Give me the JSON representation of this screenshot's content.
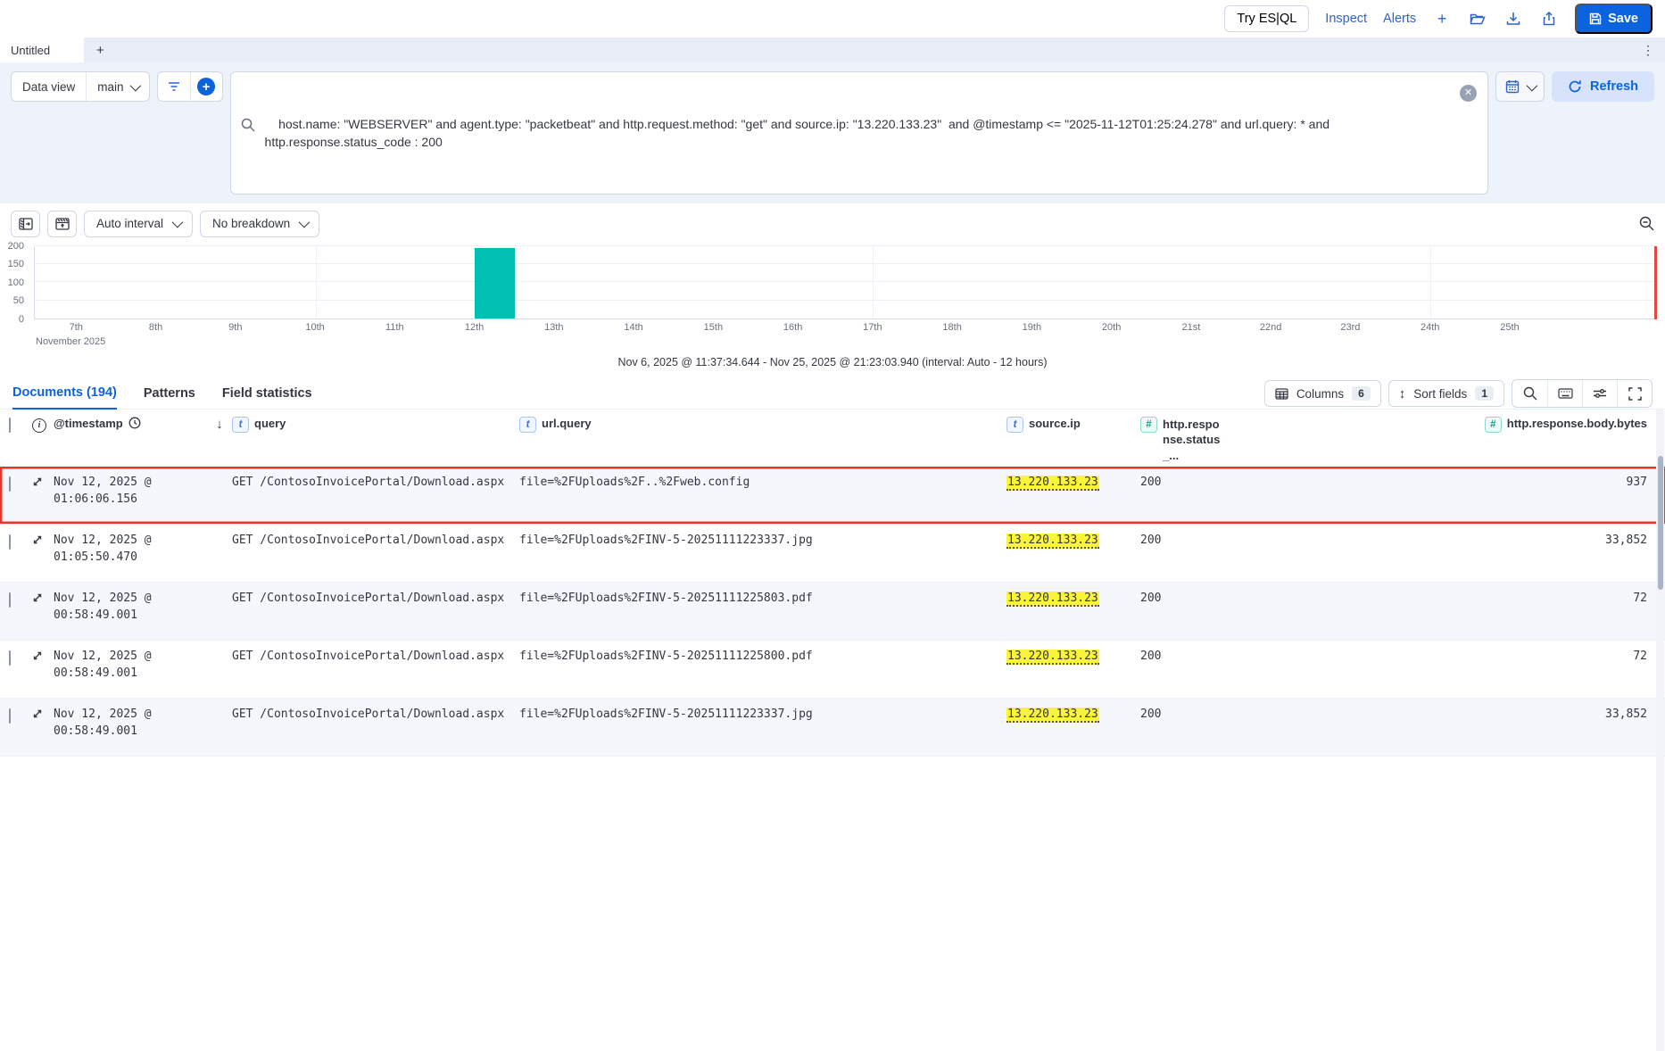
{
  "header": {
    "try_esql": "Try ES|QL",
    "inspect": "Inspect",
    "alerts": "Alerts",
    "save": "Save",
    "plus": "+"
  },
  "tab_bar": {
    "tab_title": "Untitled",
    "add": "+",
    "kebab": "⋮"
  },
  "query_bar": {
    "data_view_label": "Data view",
    "data_view_value": "main",
    "query": "host.name: \"WEBSERVER\" and agent.type: \"packetbeat\" and http.request.method: \"get\" and source.ip: \"13.220.133.23\"  and @timestamp <= \"2025-11-12T01:25:24.278\" and url.query: * and http.response.status_code : 200",
    "clear": "✕",
    "refresh": "Refresh"
  },
  "chart_controls": {
    "interval": "Auto interval",
    "breakdown": "No breakdown"
  },
  "chart_data": {
    "type": "bar",
    "title": "",
    "xlabel": "November 2025",
    "ylabel": "",
    "ylim": [
      0,
      200
    ],
    "y_ticks": [
      0,
      50,
      100,
      150,
      200
    ],
    "categories": [
      "7th",
      "8th",
      "9th",
      "10th",
      "11th",
      "12th",
      "13th",
      "14th",
      "15th",
      "16th",
      "17th",
      "18th",
      "19th",
      "20th",
      "21st",
      "22nd",
      "23rd",
      "24th",
      "25th"
    ],
    "values": [
      0,
      0,
      0,
      0,
      0,
      194,
      0,
      0,
      0,
      0,
      0,
      0,
      0,
      0,
      0,
      0,
      0,
      0,
      0
    ],
    "bars": [
      {
        "category_index": 5,
        "category": "12th",
        "value": 194
      }
    ],
    "week_gridlines": [
      3,
      10,
      17
    ],
    "bar_color": "#00BFB3",
    "now_line_color": "#e5493d",
    "grid": true,
    "legend_position": "none",
    "interval": "12 hours"
  },
  "summary": "Nov 6, 2025 @ 11:37:34.644 - Nov 25, 2025 @ 21:23:03.940 (interval: Auto - 12 hours)",
  "doc_tabs": {
    "documents": "Documents (194)",
    "patterns": "Patterns",
    "field_statistics": "Field statistics"
  },
  "grid_controls": {
    "columns_label": "Columns",
    "columns_count": "6",
    "sort_label": "Sort fields",
    "sort_count": "1"
  },
  "table": {
    "headers": {
      "timestamp": "@timestamp",
      "sort_arrow": "↓",
      "query": "query",
      "url_query": "url.query",
      "source_ip": "source.ip",
      "status_code": "http.response.status_...",
      "body_bytes": "http.response.body.bytes"
    },
    "rows": [
      {
        "timestamp": "Nov 12, 2025 @ 01:06:06.156",
        "query": "GET /ContosoInvoicePortal/Download.aspx",
        "url_query": "file=%2FUploads%2F..%2Fweb.config",
        "source_ip": "13.220.133.23",
        "status_code": "200",
        "body_bytes": "937"
      },
      {
        "timestamp": "Nov 12, 2025 @ 01:05:50.470",
        "query": "GET /ContosoInvoicePortal/Download.aspx",
        "url_query": "file=%2FUploads%2FINV-5-20251111223337.jpg",
        "source_ip": "13.220.133.23",
        "status_code": "200",
        "body_bytes": "33,852"
      },
      {
        "timestamp": "Nov 12, 2025 @ 00:58:49.001",
        "query": "GET /ContosoInvoicePortal/Download.aspx",
        "url_query": "file=%2FUploads%2FINV-5-20251111225803.pdf",
        "source_ip": "13.220.133.23",
        "status_code": "200",
        "body_bytes": "72"
      },
      {
        "timestamp": "Nov 12, 2025 @ 00:58:49.001",
        "query": "GET /ContosoInvoicePortal/Download.aspx",
        "url_query": "file=%2FUploads%2FINV-5-20251111225800.pdf",
        "source_ip": "13.220.133.23",
        "status_code": "200",
        "body_bytes": "72"
      },
      {
        "timestamp": "Nov 12, 2025 @ 00:58:49.001",
        "query": "GET /ContosoInvoicePortal/Download.aspx",
        "url_query": "file=%2FUploads%2FINV-5-20251111223337.jpg",
        "source_ip": "13.220.133.23",
        "status_code": "200",
        "body_bytes": "33,852"
      }
    ],
    "highlighted_row_index": 0,
    "highlight_color": "#e5362c",
    "ip_highlight_color": "#fbf53a"
  }
}
